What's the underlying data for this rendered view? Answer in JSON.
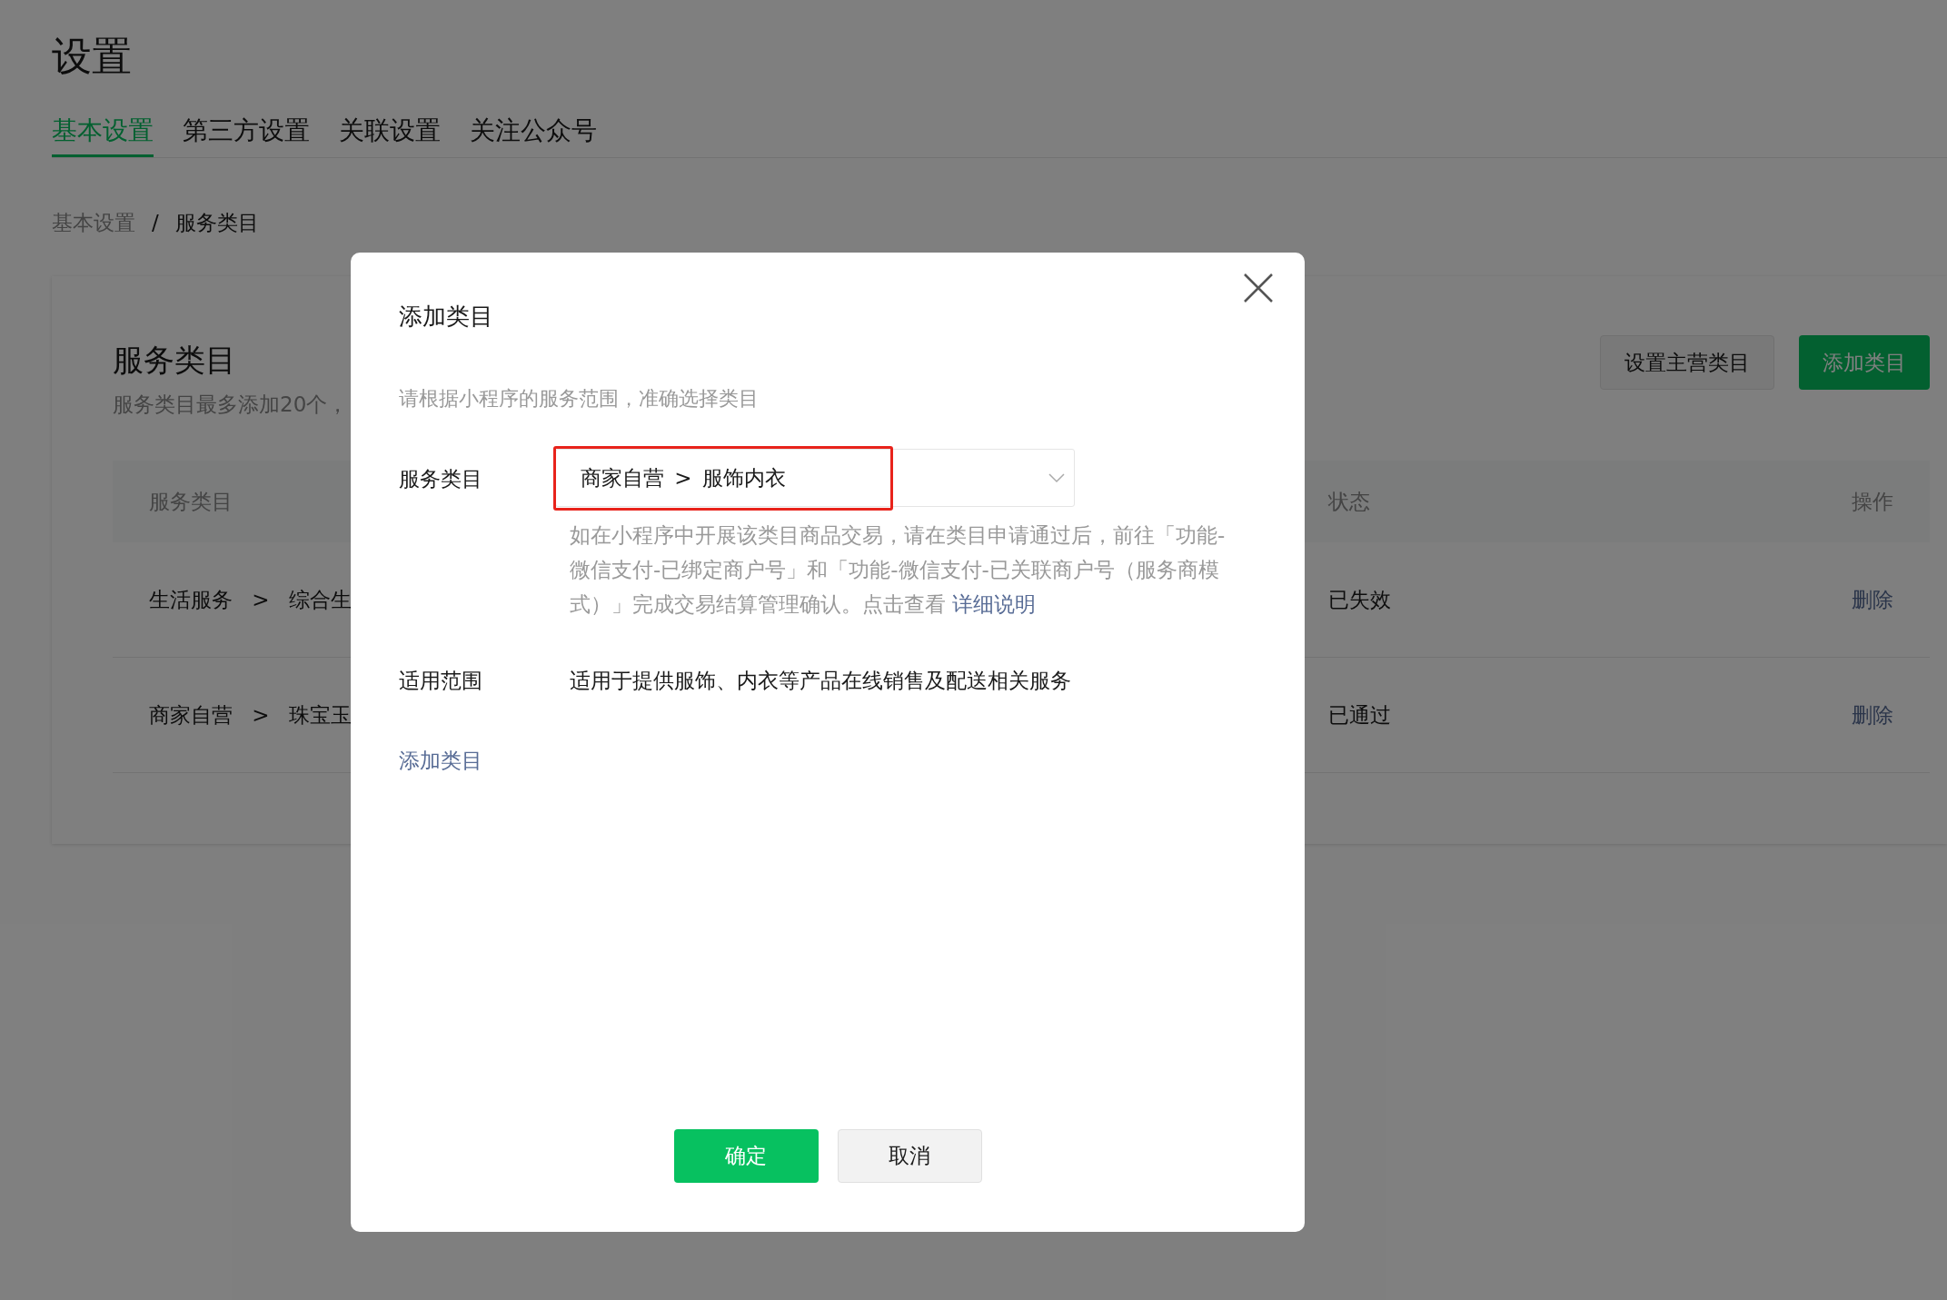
{
  "page": {
    "title": "设置"
  },
  "tabs": [
    {
      "label": "基本设置",
      "selected": true
    },
    {
      "label": "第三方设置",
      "selected": false
    },
    {
      "label": "关联设置",
      "selected": false
    },
    {
      "label": "关注公众号",
      "selected": false
    }
  ],
  "breadcrumb": {
    "items": [
      "基本设置",
      "服务类目"
    ],
    "separator": "/"
  },
  "card": {
    "title": "服务类目",
    "description": "服务类目最多添加20个，",
    "buttons": [
      {
        "label": "设置主营类目",
        "kind": "secondary"
      },
      {
        "label": "添加类目",
        "kind": "primary"
      }
    ],
    "table": {
      "columns": [
        "服务类目",
        "状态",
        "操作"
      ],
      "rows": [
        {
          "category": "生活服务 > 综合生",
          "status": "已失效",
          "action": "删除"
        },
        {
          "category": "商家自营 > 珠宝玉",
          "status": "已通过",
          "action": "删除"
        }
      ]
    }
  },
  "dialog": {
    "title": "添加类目",
    "intro": "请根据小程序的服务范围，准确选择类目",
    "fields": [
      {
        "label": "服务类目",
        "kind": "select",
        "value": "商家自营 > 服饰内衣",
        "highlighted": true,
        "help": "如在小程序中开展该类目商品交易，请在类目申请通过后，前往「功能-微信支付-已绑定商户号」和「功能-微信支付-已关联商户号（服务商模式）」完成交易结算管理确认。点击查看 ",
        "help_link": "详细说明"
      },
      {
        "label": "适用范围",
        "kind": "text",
        "value": "适用于提供服饰、内衣等产品在线销售及配送相关服务"
      }
    ],
    "add_link": "添加类目",
    "buttons": [
      {
        "label": "确定",
        "kind": "primary"
      },
      {
        "label": "取消",
        "kind": "secondary"
      }
    ]
  }
}
